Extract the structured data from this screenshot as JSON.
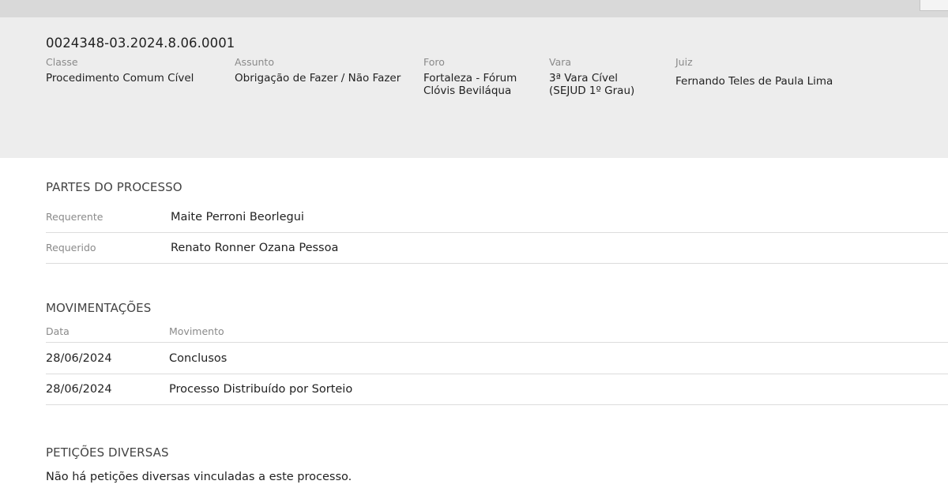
{
  "process": {
    "number": "0024348-03.2024.8.06.0001",
    "fields": [
      {
        "label": "Classe",
        "value": "Procedimento Comum Cível"
      },
      {
        "label": "Assunto",
        "value": "Obrigação de Fazer / Não Fazer"
      },
      {
        "label": "Foro",
        "value_lines": [
          "Fortaleza - Fórum",
          "Clóvis Beviláqua"
        ]
      },
      {
        "label": "Vara",
        "value_lines": [
          "3ª Vara Cível",
          "(SEJUD 1º Grau)"
        ]
      },
      {
        "label": "Juiz",
        "value": "Fernando Teles de Paula Lima"
      }
    ]
  },
  "partes": {
    "title": "PARTES DO PROCESSO",
    "rows": [
      {
        "role": "Requerente",
        "name": "Maite Perroni Beorlegui"
      },
      {
        "role": "Requerido",
        "name": "Renato Ronner Ozana Pessoa"
      }
    ]
  },
  "movimentacoes": {
    "title": "MOVIMENTAÇÕES",
    "columns": [
      "Data",
      "Movimento"
    ],
    "rows": [
      {
        "date": "28/06/2024",
        "desc": "Conclusos"
      },
      {
        "date": "28/06/2024",
        "desc": "Processo Distribuído por Sorteio"
      }
    ]
  },
  "peticoes": {
    "title": "PETIÇÕES DIVERSAS",
    "empty_message": "Não há petições diversas vinculadas a este processo."
  }
}
